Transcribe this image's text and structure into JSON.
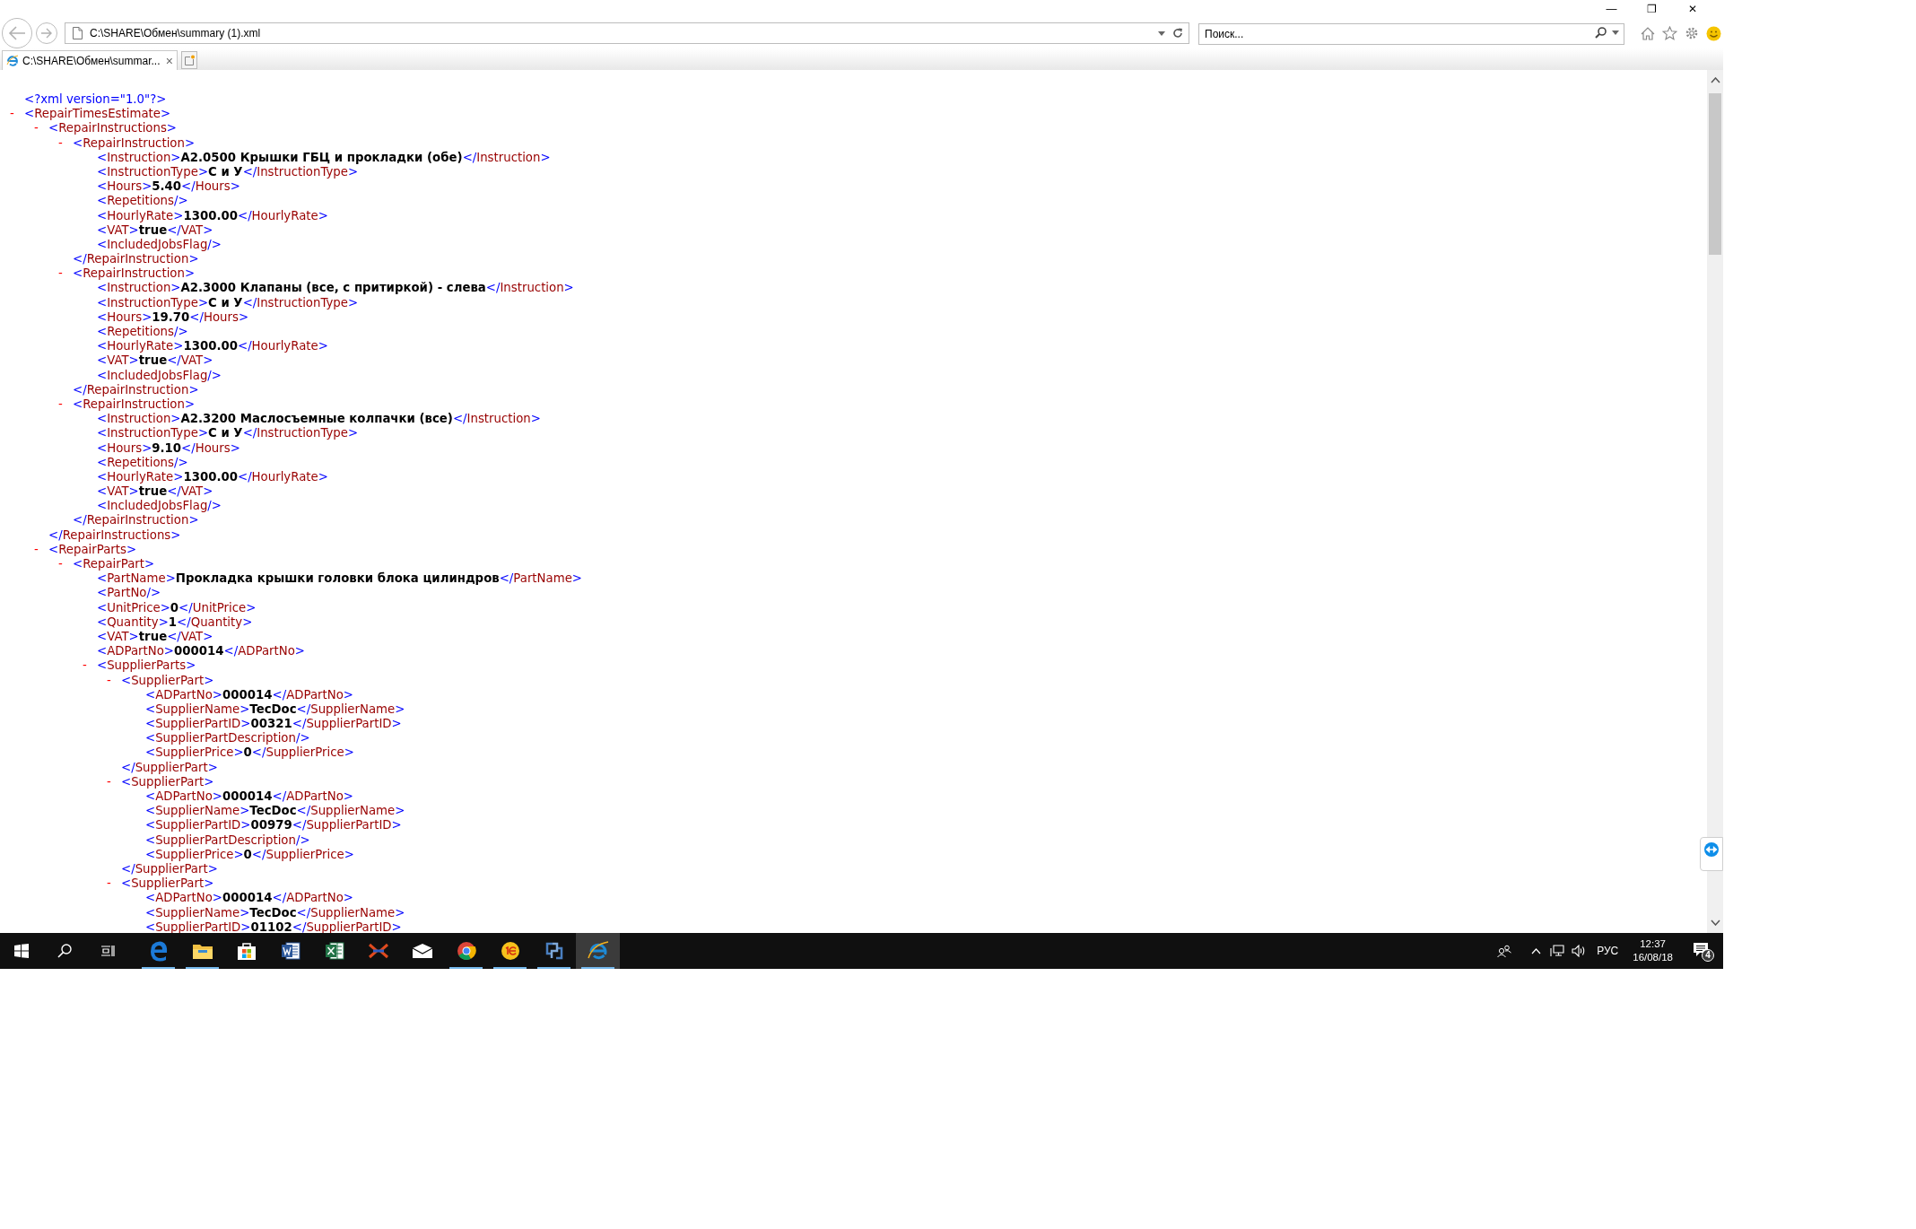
{
  "window": {
    "controls": [
      "—",
      "❐",
      "✕"
    ]
  },
  "address_bar": {
    "value": "C:\\SHARE\\Обмен\\summary (1).xml"
  },
  "search": {
    "placeholder": "Поиск..."
  },
  "tabs": [
    {
      "label": "C:\\SHARE\\Обмен\\summar...",
      "close": "×",
      "selected": true
    }
  ],
  "document": [
    {
      "kind": "declaration",
      "text": "<?xml version=\"1.0\"?>"
    },
    {
      "kind": "node",
      "toggle": "-",
      "open": "<RepairTimesEstimate>",
      "children": [
        {
          "kind": "node",
          "toggle": "-",
          "open": "<RepairInstructions>",
          "children": [
            {
              "kind": "node",
              "toggle": "-",
              "open": "<RepairInstruction>",
              "children": [
                {
                  "kind": "element",
                  "open": "<Instruction>",
                  "value": "A2.0500 Крышки ГБЦ и прокладки (обе)",
                  "close": "</Instruction>"
                },
                {
                  "kind": "element",
                  "open": "<InstructionType>",
                  "value": "С и У",
                  "close": "</InstructionType>"
                },
                {
                  "kind": "element",
                  "open": "<Hours>",
                  "value": "5.40",
                  "close": "</Hours>"
                },
                {
                  "kind": "empty",
                  "open": "<Repetitions/>"
                },
                {
                  "kind": "element",
                  "open": "<HourlyRate>",
                  "value": "1300.00",
                  "close": "</HourlyRate>"
                },
                {
                  "kind": "element",
                  "open": "<VAT>",
                  "value": "true",
                  "close": "</VAT>"
                },
                {
                  "kind": "empty",
                  "open": "<IncludedJobsFlag/>"
                }
              ],
              "close": "</RepairInstruction>"
            },
            {
              "kind": "node",
              "toggle": "-",
              "open": "<RepairInstruction>",
              "children": [
                {
                  "kind": "element",
                  "open": "<Instruction>",
                  "value": "A2.3000 Клапаны (все, с притиркой) - слева",
                  "close": "</Instruction>"
                },
                {
                  "kind": "element",
                  "open": "<InstructionType>",
                  "value": "С и У",
                  "close": "</InstructionType>"
                },
                {
                  "kind": "element",
                  "open": "<Hours>",
                  "value": "19.70",
                  "close": "</Hours>"
                },
                {
                  "kind": "empty",
                  "open": "<Repetitions/>"
                },
                {
                  "kind": "element",
                  "open": "<HourlyRate>",
                  "value": "1300.00",
                  "close": "</HourlyRate>"
                },
                {
                  "kind": "element",
                  "open": "<VAT>",
                  "value": "true",
                  "close": "</VAT>"
                },
                {
                  "kind": "empty",
                  "open": "<IncludedJobsFlag/>"
                }
              ],
              "close": "</RepairInstruction>"
            },
            {
              "kind": "node",
              "toggle": "-",
              "open": "<RepairInstruction>",
              "children": [
                {
                  "kind": "element",
                  "open": "<Instruction>",
                  "value": "A2.3200 Маслосъемные колпачки (все)",
                  "close": "</Instruction>"
                },
                {
                  "kind": "element",
                  "open": "<InstructionType>",
                  "value": "С и У",
                  "close": "</InstructionType>"
                },
                {
                  "kind": "element",
                  "open": "<Hours>",
                  "value": "9.10",
                  "close": "</Hours>"
                },
                {
                  "kind": "empty",
                  "open": "<Repetitions/>"
                },
                {
                  "kind": "element",
                  "open": "<HourlyRate>",
                  "value": "1300.00",
                  "close": "</HourlyRate>"
                },
                {
                  "kind": "element",
                  "open": "<VAT>",
                  "value": "true",
                  "close": "</VAT>"
                },
                {
                  "kind": "empty",
                  "open": "<IncludedJobsFlag/>"
                }
              ],
              "close": "</RepairInstruction>"
            }
          ],
          "close": "</RepairInstructions>"
        },
        {
          "kind": "node",
          "toggle": "-",
          "open": "<RepairParts>",
          "children": [
            {
              "kind": "node",
              "toggle": "-",
              "open": "<RepairPart>",
              "children": [
                {
                  "kind": "element",
                  "open": "<PartName>",
                  "value": "Прокладка крышки головки блока цилиндров",
                  "close": "</PartName>"
                },
                {
                  "kind": "empty",
                  "open": "<PartNo/>"
                },
                {
                  "kind": "element",
                  "open": "<UnitPrice>",
                  "value": "0",
                  "close": "</UnitPrice>"
                },
                {
                  "kind": "element",
                  "open": "<Quantity>",
                  "value": "1",
                  "close": "</Quantity>"
                },
                {
                  "kind": "element",
                  "open": "<VAT>",
                  "value": "true",
                  "close": "</VAT>"
                },
                {
                  "kind": "element",
                  "open": "<ADPartNo>",
                  "value": "000014",
                  "close": "</ADPartNo>"
                },
                {
                  "kind": "node",
                  "toggle": "-",
                  "open": "<SupplierParts>",
                  "children": [
                    {
                      "kind": "node",
                      "toggle": "-",
                      "open": "<SupplierPart>",
                      "children": [
                        {
                          "kind": "element",
                          "open": "<ADPartNo>",
                          "value": "000014",
                          "close": "</ADPartNo>"
                        },
                        {
                          "kind": "element",
                          "open": "<SupplierName>",
                          "value": "TecDoc",
                          "close": "</SupplierName>"
                        },
                        {
                          "kind": "element",
                          "open": "<SupplierPartID>",
                          "value": "00321",
                          "close": "</SupplierPartID>"
                        },
                        {
                          "kind": "empty",
                          "open": "<SupplierPartDescription/>"
                        },
                        {
                          "kind": "element",
                          "open": "<SupplierPrice>",
                          "value": "0",
                          "close": "</SupplierPrice>"
                        }
                      ],
                      "close": "</SupplierPart>"
                    },
                    {
                      "kind": "node",
                      "toggle": "-",
                      "open": "<SupplierPart>",
                      "children": [
                        {
                          "kind": "element",
                          "open": "<ADPartNo>",
                          "value": "000014",
                          "close": "</ADPartNo>"
                        },
                        {
                          "kind": "element",
                          "open": "<SupplierName>",
                          "value": "TecDoc",
                          "close": "</SupplierName>"
                        },
                        {
                          "kind": "element",
                          "open": "<SupplierPartID>",
                          "value": "00979",
                          "close": "</SupplierPartID>"
                        },
                        {
                          "kind": "empty",
                          "open": "<SupplierPartDescription/>"
                        },
                        {
                          "kind": "element",
                          "open": "<SupplierPrice>",
                          "value": "0",
                          "close": "</SupplierPrice>"
                        }
                      ],
                      "close": "</SupplierPart>"
                    },
                    {
                      "kind": "node",
                      "toggle": "-",
                      "open": "<SupplierPart>",
                      "children": [
                        {
                          "kind": "element",
                          "open": "<ADPartNo>",
                          "value": "000014",
                          "close": "</ADPartNo>"
                        },
                        {
                          "kind": "element",
                          "open": "<SupplierName>",
                          "value": "TecDoc",
                          "close": "</SupplierName>"
                        },
                        {
                          "kind": "element",
                          "open": "<SupplierPartID>",
                          "value": "01102",
                          "close": "</SupplierPartID>"
                        }
                      ]
                    }
                  ]
                }
              ]
            }
          ]
        }
      ]
    }
  ],
  "taskbar": {
    "apps": [
      {
        "kind": "edge",
        "running": true,
        "selected": false
      },
      {
        "kind": "explorer",
        "running": true,
        "selected": false
      },
      {
        "kind": "store",
        "running": false,
        "selected": false
      },
      {
        "kind": "word",
        "running": false,
        "selected": false
      },
      {
        "kind": "excel",
        "running": false,
        "selected": false
      },
      {
        "kind": "x",
        "running": false,
        "selected": false
      },
      {
        "kind": "mail",
        "running": false,
        "selected": false
      },
      {
        "kind": "chrome",
        "running": true,
        "selected": false
      },
      {
        "kind": "onec",
        "running": true,
        "selected": false
      },
      {
        "kind": "sync",
        "running": true,
        "selected": false
      },
      {
        "kind": "ie",
        "running": true,
        "selected": true
      }
    ],
    "language": "РУС",
    "time": "12:37",
    "date": "16/08/18",
    "notifications": "4"
  }
}
